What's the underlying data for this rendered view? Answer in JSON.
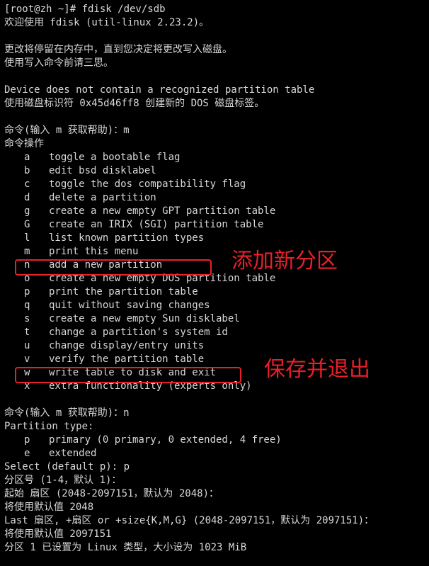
{
  "terminal": {
    "header": [
      "[root@zh ~]# fdisk /dev/sdb",
      "欢迎使用 fdisk (util-linux 2.23.2)。",
      "",
      "更改将停留在内存中，直到您决定将更改写入磁盘。",
      "使用写入命令前请三思。",
      "",
      "Device does not contain a recognized partition table",
      "使用磁盘标识符 0x45d46ff8 创建新的 DOS 磁盘标签。",
      "",
      "命令(输入 m 获取帮助)：m",
      "命令操作"
    ],
    "menu": [
      {
        "key": "a",
        "desc": "toggle a bootable flag"
      },
      {
        "key": "b",
        "desc": "edit bsd disklabel"
      },
      {
        "key": "c",
        "desc": "toggle the dos compatibility flag"
      },
      {
        "key": "d",
        "desc": "delete a partition"
      },
      {
        "key": "g",
        "desc": "create a new empty GPT partition table"
      },
      {
        "key": "G",
        "desc": "create an IRIX (SGI) partition table"
      },
      {
        "key": "l",
        "desc": "list known partition types"
      },
      {
        "key": "m",
        "desc": "print this menu"
      },
      {
        "key": "n",
        "desc": "add a new partition"
      },
      {
        "key": "o",
        "desc": "create a new empty DOS partition table"
      },
      {
        "key": "p",
        "desc": "print the partition table"
      },
      {
        "key": "q",
        "desc": "quit without saving changes"
      },
      {
        "key": "s",
        "desc": "create a new empty Sun disklabel"
      },
      {
        "key": "t",
        "desc": "change a partition's system id"
      },
      {
        "key": "u",
        "desc": "change display/entry units"
      },
      {
        "key": "v",
        "desc": "verify the partition table"
      },
      {
        "key": "w",
        "desc": "write table to disk and exit"
      },
      {
        "key": "x",
        "desc": "extra functionality (experts only)"
      }
    ],
    "after_menu": [
      "",
      "命令(输入 m 获取帮助)：n",
      "Partition type:"
    ],
    "partition_types": [
      {
        "key": "p",
        "desc": "primary (0 primary, 0 extended, 4 free)"
      },
      {
        "key": "e",
        "desc": "extended"
      }
    ],
    "footer": [
      "Select (default p): p",
      "分区号 (1-4，默认 1)：",
      "起始 扇区 (2048-2097151，默认为 2048)：",
      "将使用默认值 2048",
      "Last 扇区, +扇区 or +size{K,M,G} (2048-2097151，默认为 2097151)：",
      "将使用默认值 2097151",
      "分区 1 已设置为 Linux 类型，大小设为 1023 MiB"
    ]
  },
  "annotations": {
    "add_partition": "添加新分区",
    "save_exit": "保存并退出"
  },
  "colors": {
    "background": "#000000",
    "text": "#d8d8d8",
    "annotation": "#e8202a"
  }
}
